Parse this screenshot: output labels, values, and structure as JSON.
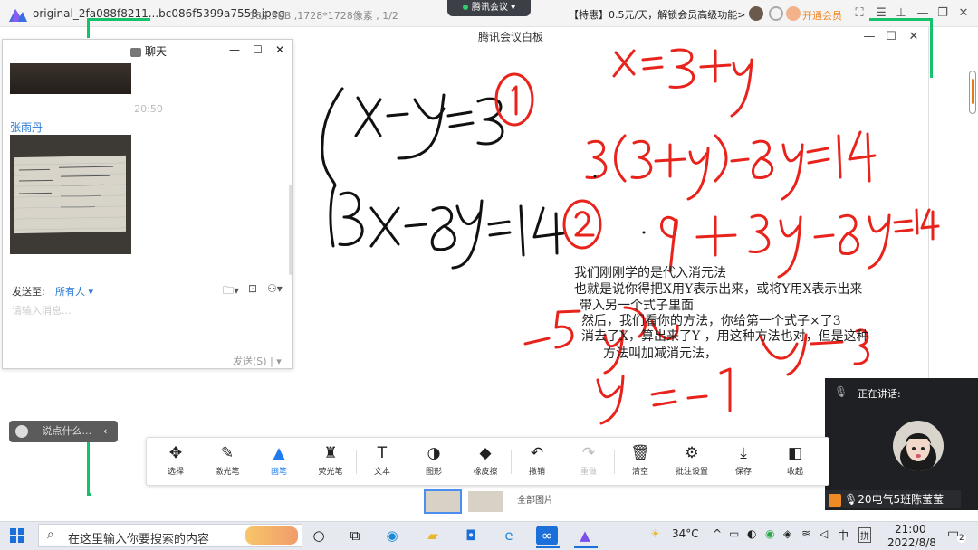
{
  "viewer": {
    "filename": "original_2fa088f8211...bc086f5399a7558.jpeg",
    "info": "182.5KB ,1728*1728像素 , 1/2",
    "promo": "【特惠】0.5元/天，解锁会员高级功能>",
    "vip": "开通会员",
    "meeting_pill": "腾讯会议"
  },
  "whiteboard": {
    "title": "腾讯会议白板",
    "typed_text": [
      "我们刚刚学的是代入消元法",
      "也就是说你得把X用Y表示出来，或将Y用X表示出来",
      "带入另一个式子里面",
      "然后，我们看你的方法，你给第一个式子×了3",
      "消去了X，算出来了Y ，用这种方法也对，但是这种",
      "方法叫加减消元法，"
    ]
  },
  "chat": {
    "title": "聊天",
    "time": "20:50",
    "sender": "张雨丹",
    "send_to_label": "发送至:",
    "send_to_value": "所有人",
    "placeholder": "请输入消息...",
    "send_button": "发送(S)"
  },
  "say_something": "说点什么...",
  "speaking": {
    "header": "正在讲话:",
    "name": "20电气5班陈莹莹"
  },
  "toolbar": {
    "tools": [
      {
        "id": "select",
        "icon": "✥",
        "label": "选择",
        "state": "normal"
      },
      {
        "id": "laser",
        "icon": "✎",
        "label": "激光笔",
        "state": "normal"
      },
      {
        "id": "pen",
        "icon": "▲",
        "label": "画笔",
        "state": "active"
      },
      {
        "id": "highlighter",
        "icon": "♜",
        "label": "荧光笔",
        "state": "normal"
      },
      {
        "id": "text",
        "icon": "T",
        "label": "文本",
        "state": "normal"
      },
      {
        "id": "shape",
        "icon": "◑",
        "label": "图形",
        "state": "normal"
      },
      {
        "id": "eraser",
        "icon": "◆",
        "label": "橡皮擦",
        "state": "normal"
      },
      {
        "id": "undo",
        "icon": "↶",
        "label": "撤销",
        "state": "normal"
      },
      {
        "id": "redo",
        "icon": "↷",
        "label": "重做",
        "state": "disabled"
      },
      {
        "id": "clear",
        "icon": "🗑",
        "label": "清空",
        "state": "normal"
      },
      {
        "id": "annotate-settings",
        "icon": "⚙",
        "label": "批注设置",
        "state": "normal"
      },
      {
        "id": "save",
        "icon": "⤓",
        "label": "保存",
        "state": "normal"
      },
      {
        "id": "collapse",
        "icon": "◧",
        "label": "收起",
        "state": "normal"
      }
    ]
  },
  "all_pictures": "全部图片",
  "taskbar": {
    "search_placeholder": "在这里输入你要搜索的内容",
    "weather": "34°C",
    "ime": "中",
    "ime2": "拼",
    "time": "21:00",
    "date": "2022/8/8",
    "notifications": "2"
  },
  "colors": {
    "accent_blue": "#1e7cf0",
    "ink_red": "#e8231c",
    "ink_black": "#111111",
    "frame_green": "#15c26b"
  }
}
